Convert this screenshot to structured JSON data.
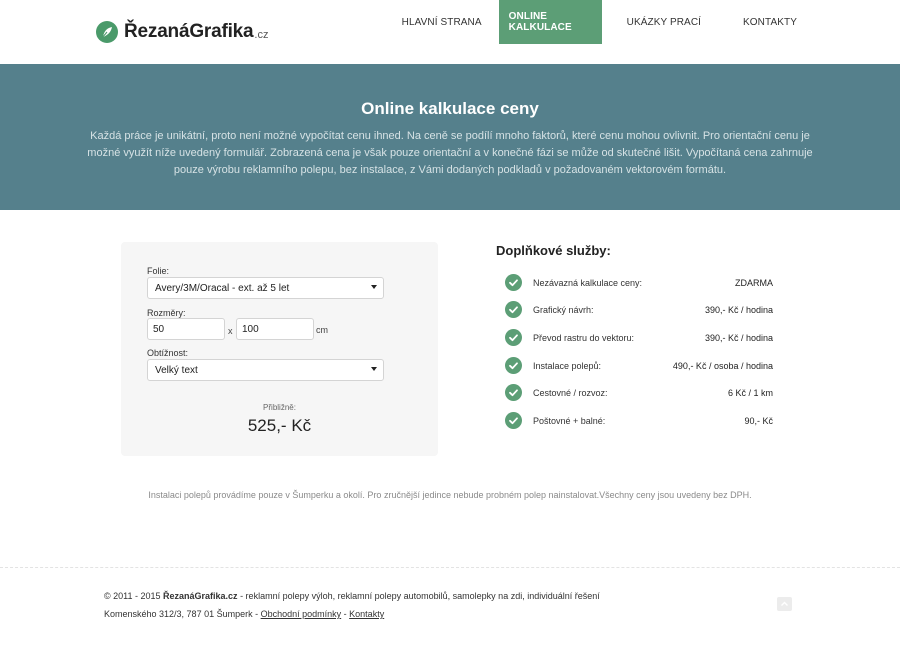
{
  "header": {
    "logo_text": "ŘezanáGrafika",
    "logo_suffix": ".cz",
    "nav": [
      {
        "label": "HLAVNÍ STRANA",
        "active": false
      },
      {
        "label": "ONLINE KALKULACE",
        "active": true
      },
      {
        "label": "UKÁZKY PRACÍ",
        "active": false
      },
      {
        "label": "KONTAKTY",
        "active": false
      }
    ]
  },
  "hero": {
    "title": "Online kalkulace ceny",
    "text": "Každá práce je unikátní, proto není možné vypočítat cenu ihned. Na ceně se podílí mnoho faktorů, které cenu mohou ovlivnit. Pro orientační cenu je možné využít níže uvedený formulář. Zobrazená cena je však pouze orientační a v konečné fázi se může od skutečné lišit. Vypočítaná cena zahrnuje pouze výrobu reklamního polepu, bez instalace, z Vámi dodaných podkladů v požadovaném vektorovém formátu."
  },
  "calculator": {
    "foil_label": "Folie:",
    "foil_value": "Avery/3M/Oracal - ext. až 5 let",
    "dims_label": "Rozměry:",
    "width_value": "50",
    "times": "x",
    "height_value": "100",
    "unit": "cm",
    "difficulty_label": "Obtížnost:",
    "difficulty_value": "Velký text",
    "approx_label": "Přibližně:",
    "price": "525,- Kč"
  },
  "services": {
    "title": "Doplňkové služby:",
    "items": [
      {
        "label": "Nezávazná kalkulace ceny:",
        "price": "ZDARMA"
      },
      {
        "label": "Grafický návrh:",
        "price": "390,- Kč / hodina"
      },
      {
        "label": "Převod rastru do vektoru:",
        "price": "390,- Kč / hodina"
      },
      {
        "label": "Instalace polepů:",
        "price": "490,- Kč / osoba / hodina"
      },
      {
        "label": "Cestovné / rozvoz:",
        "price": "6 Kč / 1 km"
      },
      {
        "label": "Poštovné + balné:",
        "price": "90,- Kč"
      }
    ]
  },
  "note": "Instalaci polepů provádíme pouze v Šumperku a okolí. Pro zručnější jedince nebude probném polep nainstalovat.Všechny ceny jsou uvedeny bez DPH.",
  "footer": {
    "line1_prefix": "© 2011 - 2015 ",
    "line1_brand": "ŘezanáGrafika.cz",
    "line1_suffix": " - reklamní polepy výloh, reklamní polepy automobilů, samolepky na zdi, individuální řešení",
    "address": "Komenského 312/3, 787 01 Šumperk - ",
    "terms_link": "Obchodní podmínky",
    "separator": " - ",
    "contacts_link": "Kontakty"
  },
  "colors": {
    "accent": "#5c9e76",
    "hero_bg": "#55808c"
  }
}
